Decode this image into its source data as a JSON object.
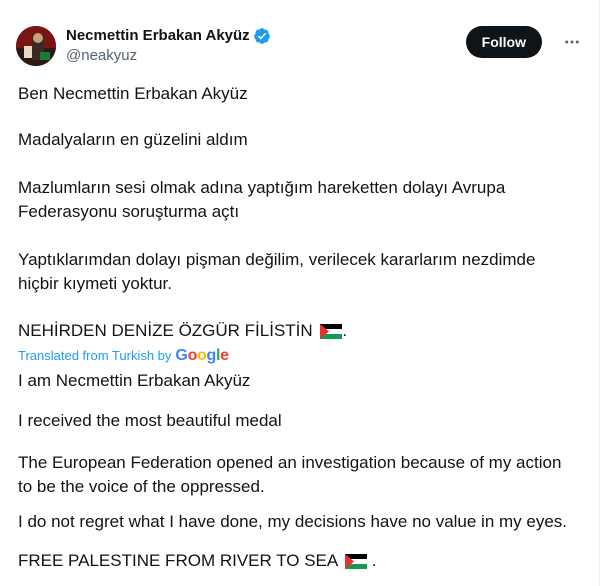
{
  "author": {
    "display_name": "Necmettin Erbakan Akyüz",
    "handle": "@neakyuz",
    "verified_icon": "verified-badge-icon",
    "avatar_icon": "avatar-image"
  },
  "actions": {
    "follow_label": "Follow",
    "more_icon": "more-options-icon"
  },
  "original": {
    "line1": "Ben Necmettin Erbakan Akyüz",
    "line2": "Madalyaların en güzelini aldım",
    "line3a": "Mazlumların sesi olmak adına yaptığım hareketten dolayı Avrupa",
    "line3b": "Federasyonu soruşturma açtı",
    "line4a": "Yaptıklarımdan dolayı pişman değilim, verilecek kararlarım nezdimde",
    "line4b": "hiçbir kıymeti yoktur.",
    "line5": "NEHİRDEN DENİZE ÖZGÜR FİLİSTİN",
    "line5_suffix": "."
  },
  "translation": {
    "label": "Translated from Turkish by",
    "provider": "Google",
    "line1": "I am Necmettin Erbakan Akyüz",
    "line2": "I received the most beautiful medal",
    "line3a": "The European Federation opened an investigation because of my action",
    "line3b": "to be the voice of the oppressed.",
    "line4": "I do not regret what I have done, my decisions have no value in my eyes.",
    "line5": "FREE PALESTINE FROM RIVER TO SEA",
    "line5_suffix": "."
  },
  "colors": {
    "text": "#0f1419",
    "secondary": "#536471",
    "accent": "#1d9bf0",
    "button_bg": "#0f1419"
  }
}
